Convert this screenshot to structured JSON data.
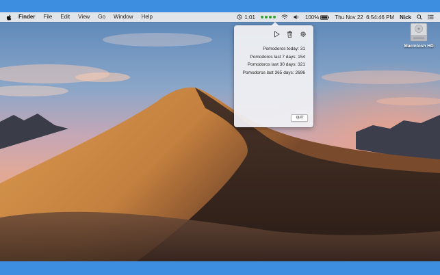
{
  "menubar": {
    "app_name": "Finder",
    "items": [
      "File",
      "Edit",
      "View",
      "Go",
      "Window",
      "Help"
    ],
    "timer": "1:01",
    "battery": "100%",
    "datetime": "Thu Nov 22  6:54:46 PM",
    "user": "Nick"
  },
  "popover": {
    "stats": [
      "Pomodoros today: 31",
      "Pomodoros last 7 days: 154",
      "Pomodoros last 30 days: 321",
      "Pomodoros last 365 days: 2696"
    ],
    "quit_label": "quit",
    "icons": [
      "play-icon",
      "trash-icon",
      "gear-icon"
    ]
  },
  "desktop": {
    "drive_label": "Macintosh HD",
    "wallpaper": "Mojave desert dune at dusk"
  },
  "colors": {
    "frame": "#3d8ee0",
    "status_dots": "#2fa12f"
  }
}
